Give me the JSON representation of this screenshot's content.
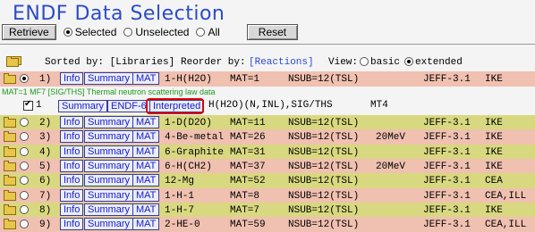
{
  "title": "ENDF Data Selection",
  "top": {
    "retrieve": "Retrieve",
    "selected": "Selected",
    "unselected": "Unselected",
    "all": "All",
    "reset": "Reset"
  },
  "sort": {
    "sorted_by": "Sorted by: [Libraries]",
    "reorder_by": "Reorder by:",
    "reorder_link": "[Reactions]",
    "view": "View:",
    "basic": "basic",
    "extended": "extended"
  },
  "buttons": {
    "info": "Info",
    "summary": "Summary",
    "mat": "MAT",
    "endf6": "ENDF-6",
    "interpreted": "Interpreted"
  },
  "rows": [
    {
      "num": "1)",
      "target": "1-H(H2O)",
      "mat": "MAT=1",
      "nsub": "NSUB=12(TSL)",
      "energy": "",
      "lib": "JEFF-3.1",
      "lab": "IKE",
      "selected": true
    },
    {
      "num": "2)",
      "target": "1-D(D2O)",
      "mat": "MAT=11",
      "nsub": "NSUB=12(TSL)",
      "energy": "",
      "lib": "JEFF-3.1",
      "lab": "IKE",
      "selected": false
    },
    {
      "num": "3)",
      "target": "4-Be-metal",
      "mat": "MAT=26",
      "nsub": "NSUB=12(TSL)",
      "energy": "20MeV",
      "lib": "JEFF-3.1",
      "lab": "IKE",
      "selected": false
    },
    {
      "num": "4)",
      "target": "6-Graphite",
      "mat": "MAT=31",
      "nsub": "NSUB=12(TSL)",
      "energy": "",
      "lib": "JEFF-3.1",
      "lab": "IKE",
      "selected": false
    },
    {
      "num": "5)",
      "target": "6-H(CH2)",
      "mat": "MAT=37",
      "nsub": "NSUB=12(TSL)",
      "energy": "20MeV",
      "lib": "JEFF-3.1",
      "lab": "IKE",
      "selected": false
    },
    {
      "num": "6)",
      "target": "12-Mg",
      "mat": "MAT=52",
      "nsub": "NSUB=12(TSL)",
      "energy": "",
      "lib": "JEFF-3.1",
      "lab": "CEA",
      "selected": false
    },
    {
      "num": "7)",
      "target": "1-H-1",
      "mat": "MAT=8",
      "nsub": "NSUB=12(TSL)",
      "energy": "",
      "lib": "JEFF-3.1",
      "lab": "CEA,ILL",
      "selected": false
    },
    {
      "num": "8)",
      "target": "1-H-7",
      "mat": "MAT=7",
      "nsub": "NSUB=12(TSL)",
      "energy": "",
      "lib": "JEFF-3.1",
      "lab": "IKE",
      "selected": false
    },
    {
      "num": "9)",
      "target": "2-HE-0",
      "mat": "MAT=59",
      "nsub": "NSUB=12(TSL)",
      "energy": "",
      "lib": "JEFF-3.1",
      "lab": "CEA,ILL",
      "selected": false
    }
  ],
  "detail": {
    "info_line": "MAT=1 MF7 [SIG/THS] Thermal neutron scattering law data",
    "index": "1",
    "reaction": "H(H2O)(N,INL),SIG/THS",
    "mt": "MT4"
  },
  "colors": {
    "title": "#2a4cc7",
    "row_pink": "#f0c0b0",
    "row_olive": "#d8d880",
    "highlight": "#e00000"
  }
}
